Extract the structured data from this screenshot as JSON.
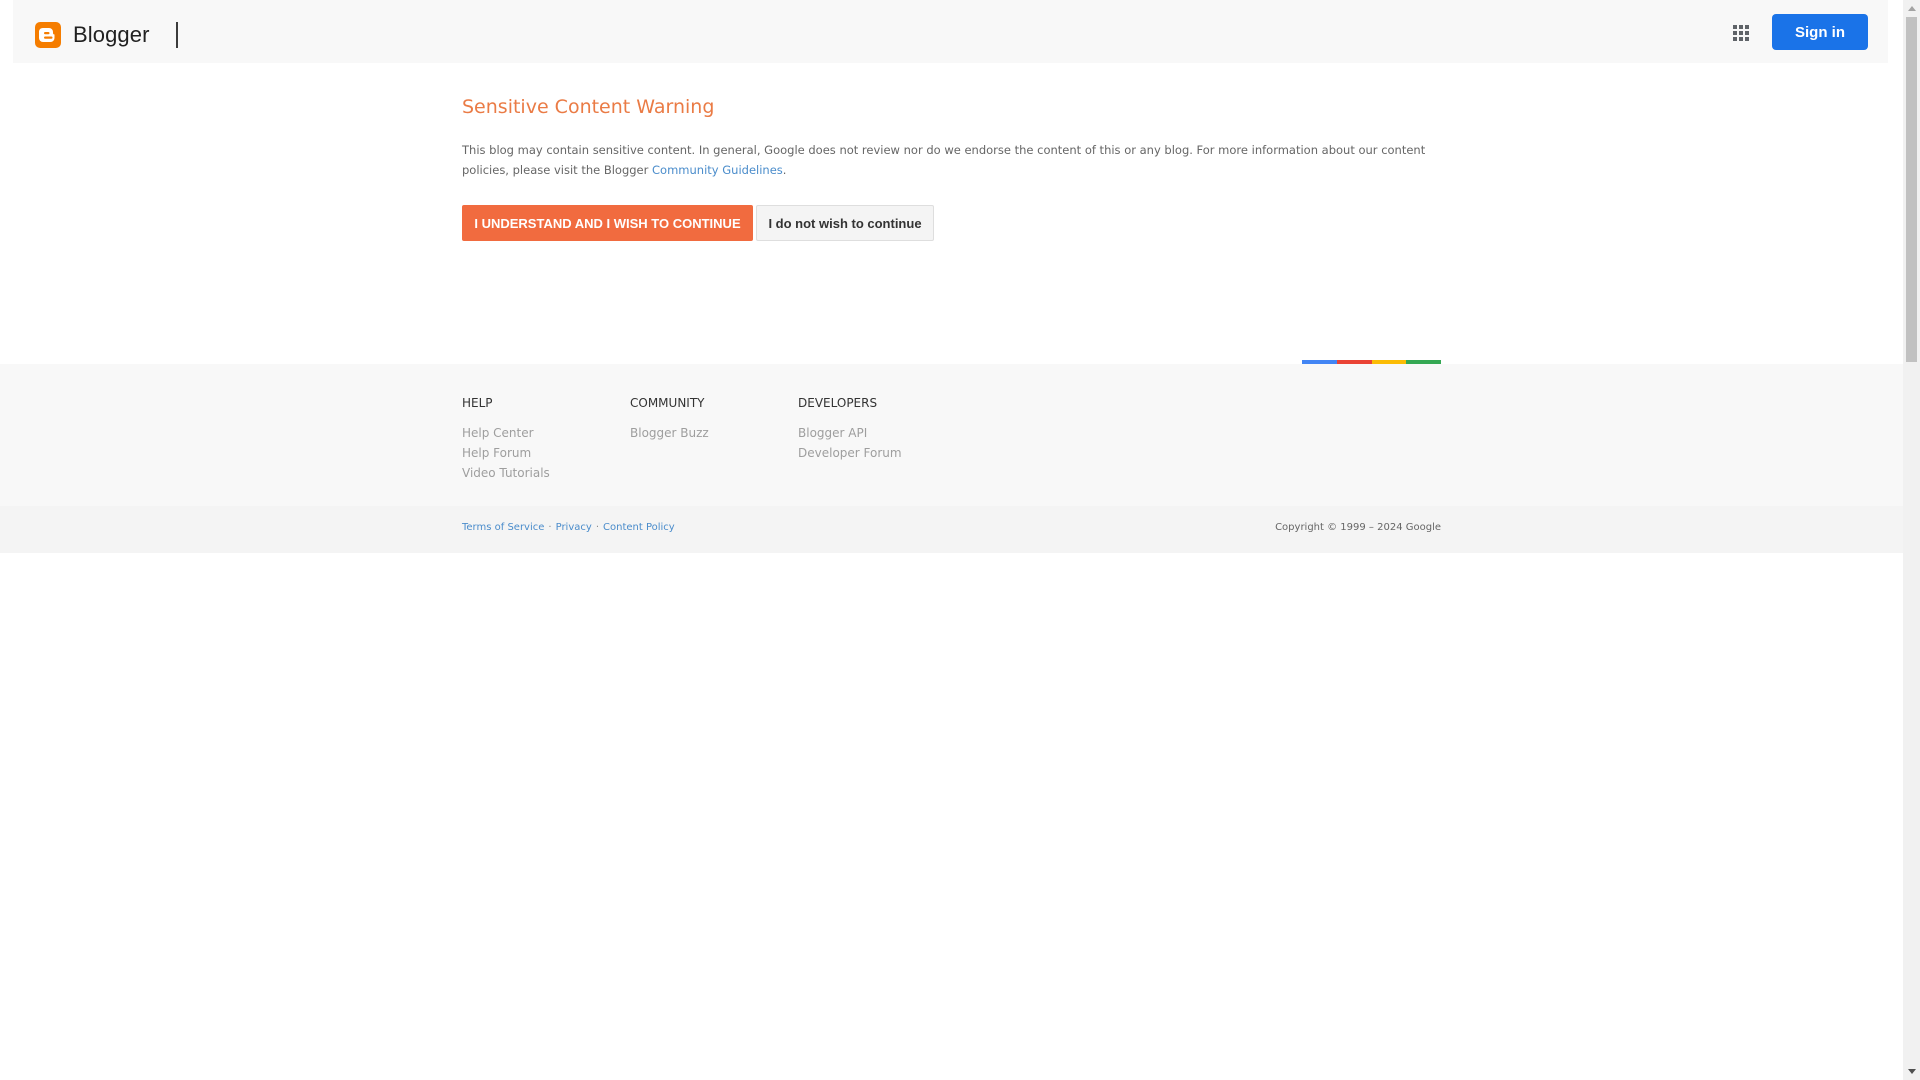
{
  "header": {
    "brand": "Blogger",
    "signin_label": "Sign in",
    "logo_color": "#f57d00"
  },
  "warning": {
    "title": "Sensitive Content Warning",
    "text_before_link": "This blog may contain sensitive content. In general, Google does not review nor do we endorse the content of this or any blog. For more information about our content policies, please visit the Blogger ",
    "link_text": "Community Guidelines",
    "text_after_link": ".",
    "continue_label": "I UNDERSTAND AND I WISH TO CONTINUE",
    "decline_label": "I do not wish to continue"
  },
  "colors": {
    "title": "#ea7b45",
    "continue_button": "#f16b3f",
    "signin_button": "#1a73e8",
    "link": "#4a8ccb",
    "bar": [
      "#4285f4",
      "#ea4335",
      "#fbbc05",
      "#34a853"
    ]
  },
  "footer": {
    "columns": [
      {
        "heading": "Help",
        "links": [
          "Help Center",
          "Help Forum",
          "Video Tutorials"
        ]
      },
      {
        "heading": "Community",
        "links": [
          "Blogger Buzz"
        ]
      },
      {
        "heading": "Developers",
        "links": [
          "Blogger API",
          "Developer Forum"
        ]
      }
    ],
    "legal": [
      "Terms of Service",
      "Privacy",
      "Content Policy"
    ],
    "separator": "·",
    "copyright": "Copyright © 1999 – 2024 Google"
  },
  "icons": {
    "logo": "blogger-logo-icon",
    "apps": "apps-grid-icon",
    "scroll_up": "scroll-up-arrow-icon",
    "scroll_down": "scroll-down-arrow-icon"
  }
}
